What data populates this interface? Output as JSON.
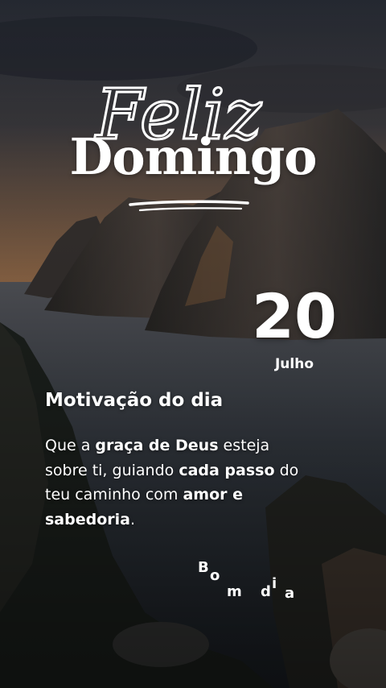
{
  "title_script": "Feliz",
  "title_main": "Domingo",
  "date": {
    "day": "20",
    "month": "Julho"
  },
  "motto_title": "Motivação do dia",
  "message": {
    "p1": "Que a ",
    "b1": "graça de Deus",
    "p2": " esteja sobre ti, guiando ",
    "b2": "cada passo",
    "p3": " do teu caminho com ",
    "b3": "amor e sabedoria",
    "p4": "."
  },
  "sign_off": {
    "c1": "B",
    "c2": "o",
    "c3": "m",
    "c4": "d",
    "c5": "i",
    "c6": "a"
  },
  "colors": {
    "text": "#ffffff",
    "sky_top": "#2b2f3a",
    "sunset": "#b07a48",
    "sea": "#3a4450"
  }
}
